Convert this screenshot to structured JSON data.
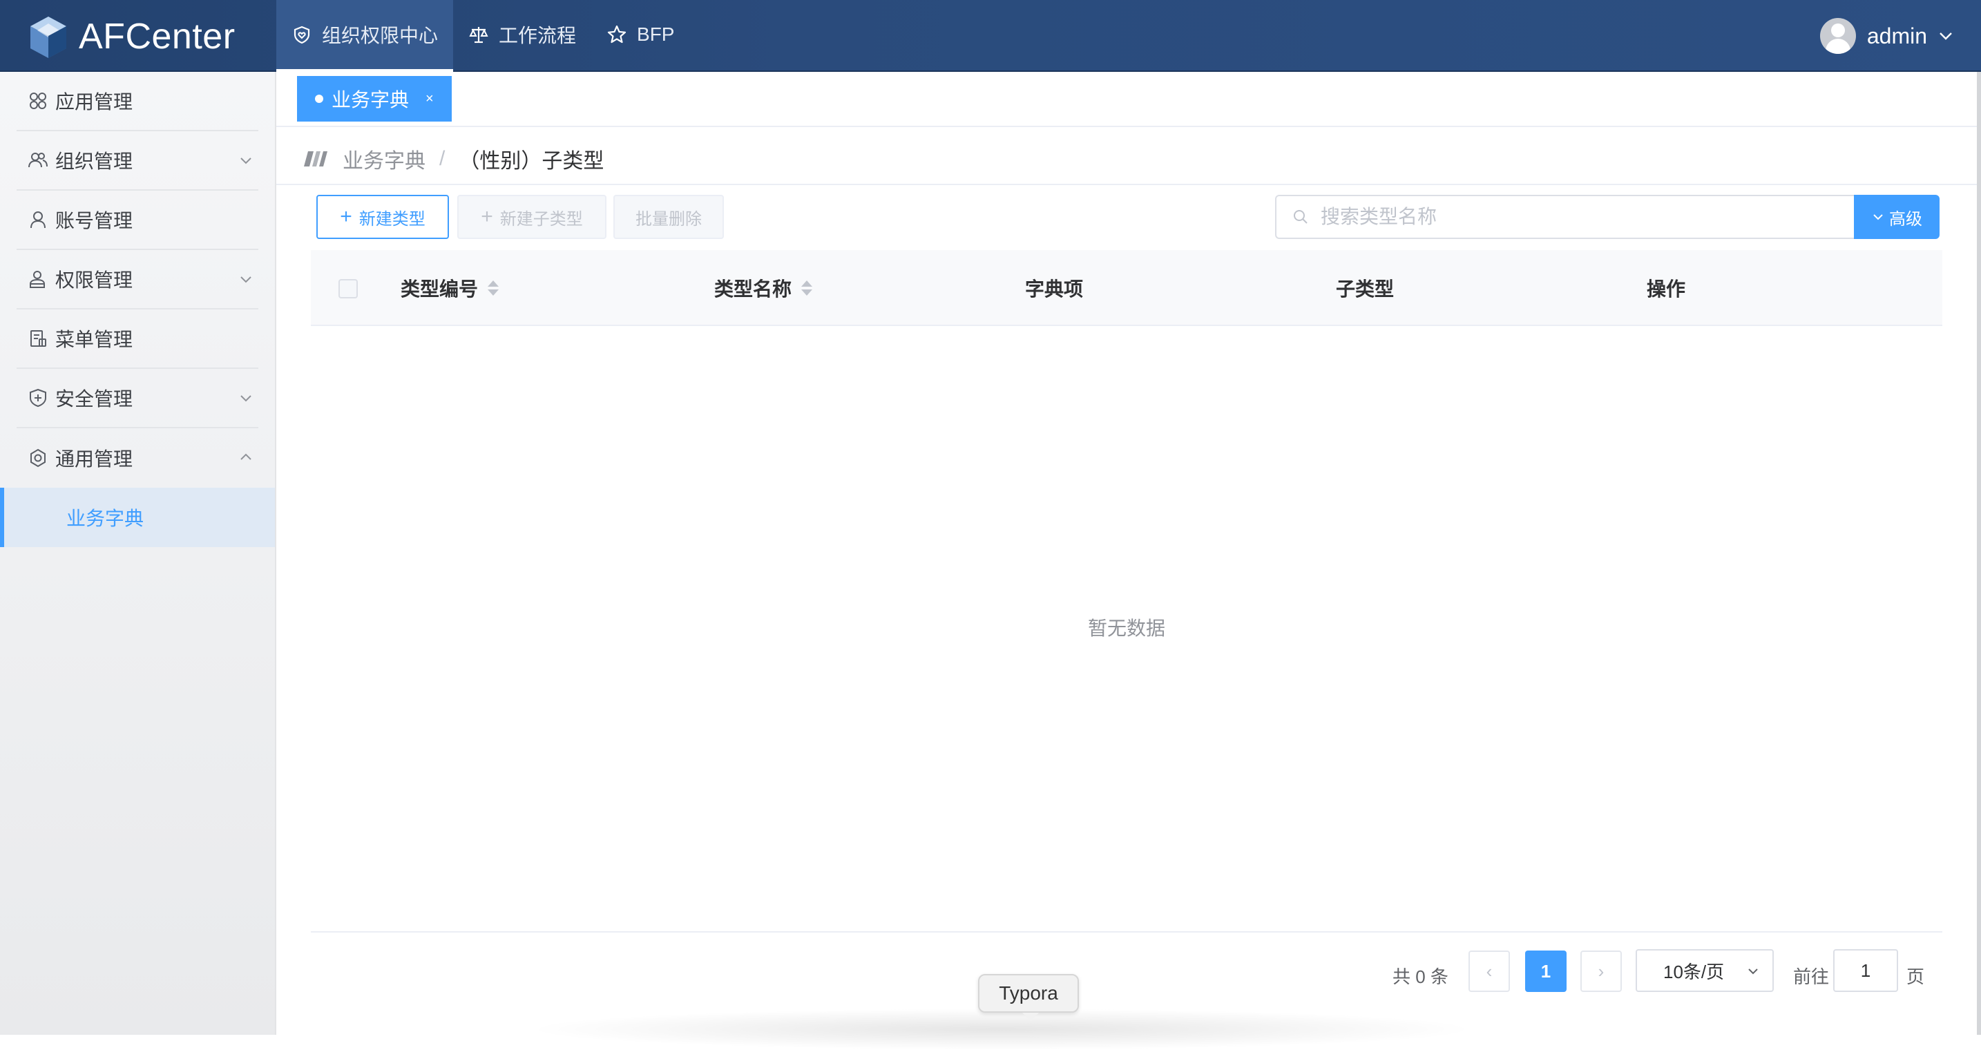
{
  "header": {
    "logo_text": "AFCenter",
    "nav": [
      {
        "label": "组织权限中心",
        "icon": "heart-shield-icon",
        "active": true
      },
      {
        "label": "工作流程",
        "icon": "scale-icon",
        "active": false
      },
      {
        "label": "BFP",
        "icon": "star-icon",
        "active": false
      }
    ],
    "user": {
      "name": "admin"
    }
  },
  "sidebar": {
    "items": [
      {
        "label": "应用管理",
        "icon": "grid-icon",
        "expandable": false
      },
      {
        "label": "组织管理",
        "icon": "users-icon",
        "expandable": true
      },
      {
        "label": "账号管理",
        "icon": "user-icon",
        "expandable": false
      },
      {
        "label": "权限管理",
        "icon": "user-lock-icon",
        "expandable": true
      },
      {
        "label": "菜单管理",
        "icon": "document-icon",
        "expandable": false
      },
      {
        "label": "安全管理",
        "icon": "shield-plus-icon",
        "expandable": true
      },
      {
        "label": "通用管理",
        "icon": "gear-icon",
        "expandable": true,
        "expanded": true
      }
    ],
    "sub_items": [
      {
        "label": "业务字典",
        "active": true
      }
    ]
  },
  "tabs": [
    {
      "label": "业务字典",
      "close": "×",
      "active": true
    }
  ],
  "breadcrumb": {
    "items": [
      "业务字典",
      "（性别）子类型"
    ],
    "separator": "/"
  },
  "toolbar": {
    "new_type": "新建类型",
    "new_subtype": "新建子类型",
    "batch_delete": "批量删除",
    "plus": "+",
    "search_placeholder": "搜索类型名称",
    "search_value": "",
    "advanced": "高级"
  },
  "table": {
    "columns": [
      "类型编号",
      "类型名称",
      "字典项",
      "子类型",
      "操作"
    ],
    "rows": [],
    "empty_text": "暂无数据"
  },
  "pagination": {
    "total_text": "共 0 条",
    "prev": "‹",
    "next": "›",
    "current_page": "1",
    "page_size": "10条/页",
    "goto_label": "前往",
    "goto_value": "1",
    "goto_unit": "页"
  },
  "tooltip": {
    "text": "Typora"
  },
  "colors": {
    "primary": "#409eff",
    "header": "#2a4b7c"
  }
}
